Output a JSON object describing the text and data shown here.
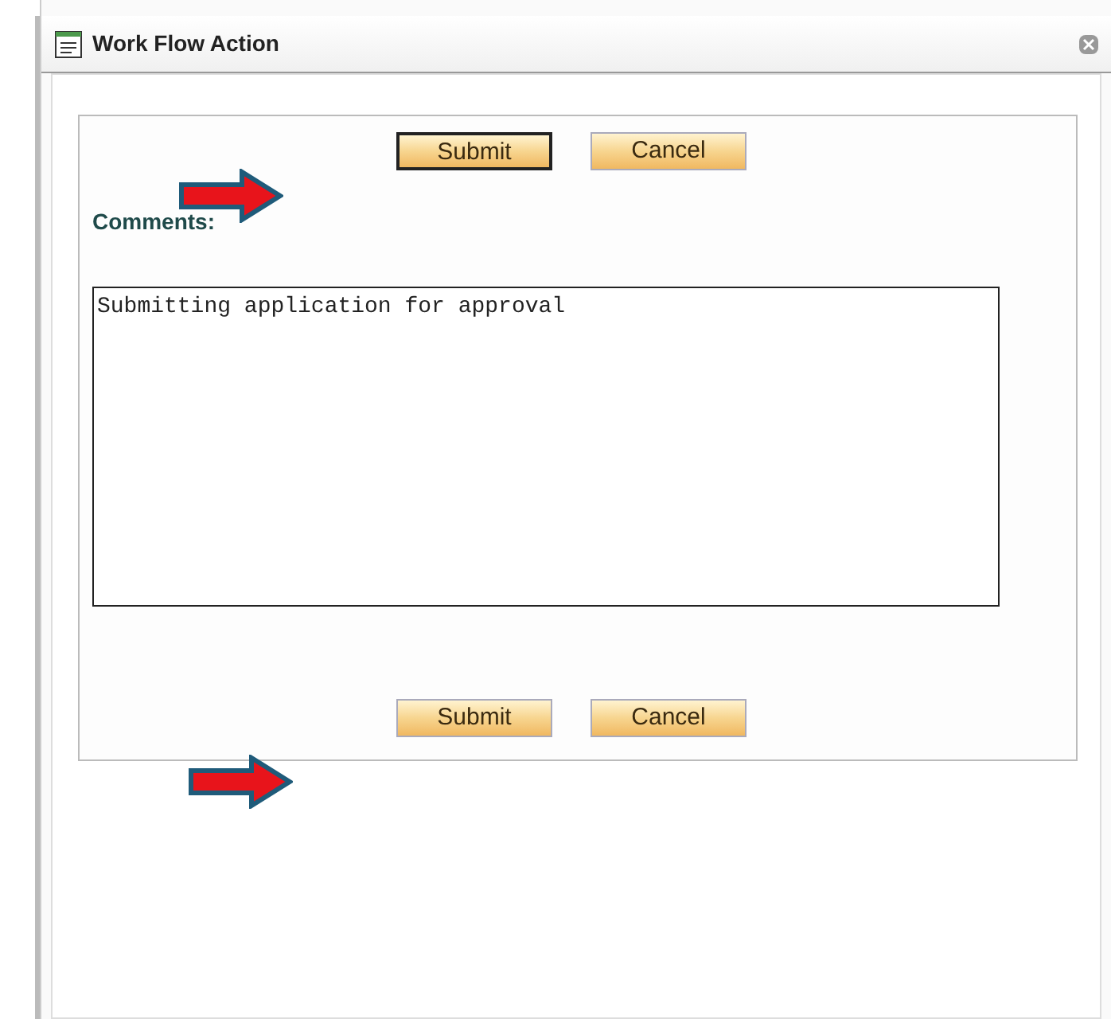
{
  "window": {
    "title": "Work Flow Action"
  },
  "top_buttons": [
    {
      "label": "Submit",
      "focused": true
    },
    {
      "label": "Cancel",
      "focused": false
    }
  ],
  "comments": {
    "label": "Comments:",
    "value": "Submitting application for approval"
  },
  "bottom_buttons": [
    {
      "label": "Submit",
      "focused": false
    },
    {
      "label": "Cancel",
      "focused": false
    }
  ]
}
